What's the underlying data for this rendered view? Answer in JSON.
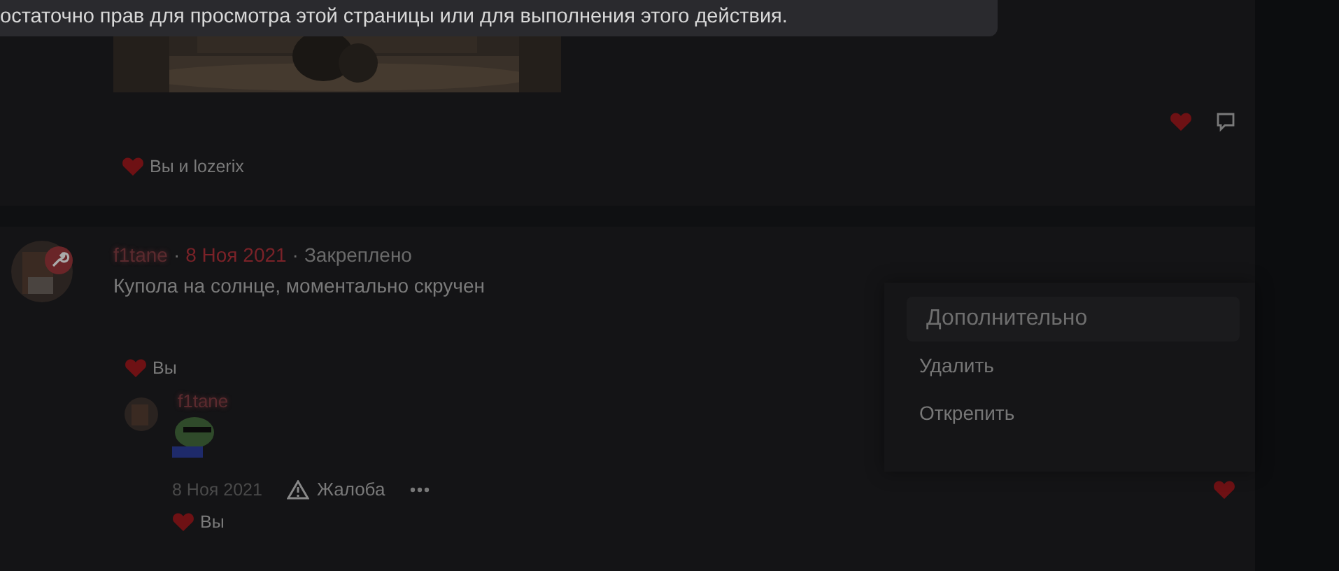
{
  "toast": {
    "text": "остаточно прав для просмотра этой страницы или для выполнения этого действия."
  },
  "first_post": {
    "liked": true,
    "likes": "Вы и lozerix"
  },
  "second_post": {
    "author": "f1tane",
    "separator_1": "·",
    "date": "8 Ноя 2021",
    "separator_2": "·",
    "status": "Закреплено",
    "body": "Купола на солнце, моментально скручен",
    "likes": "Вы",
    "reply": {
      "author": "f1tane",
      "date": "8 Ноя 2021",
      "report": "Жалоба",
      "liked": true,
      "likes": "Вы"
    },
    "menu": {
      "title": "Дополнительно",
      "items": [
        {
          "label": "Удалить"
        },
        {
          "label": "Открепить"
        }
      ]
    }
  }
}
